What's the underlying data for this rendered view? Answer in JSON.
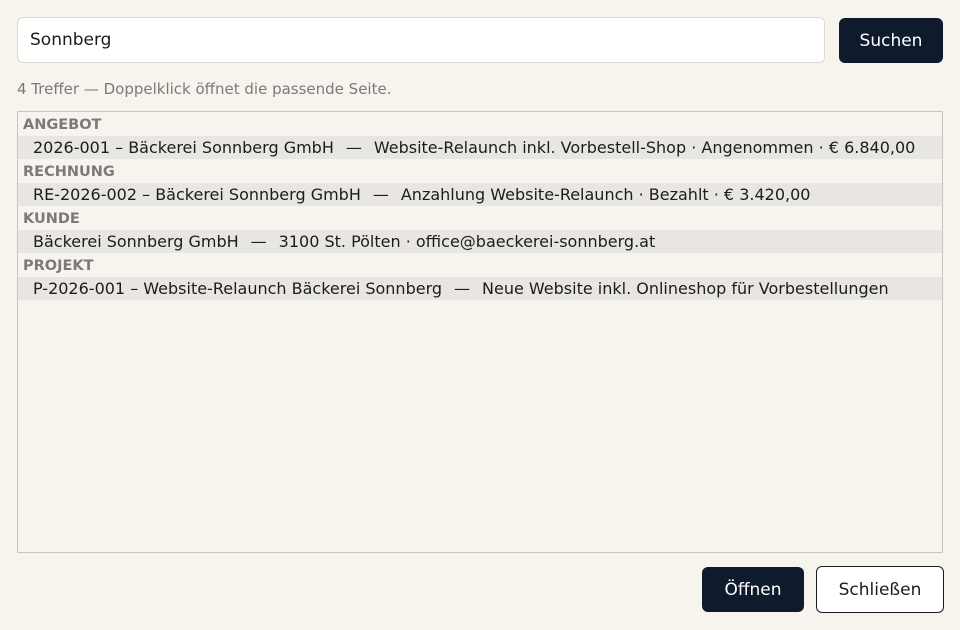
{
  "search": {
    "value": "Sonnberg",
    "button_label": "Suchen"
  },
  "hint": "4 Treffer — Doppelklick öffnet die passende Seite.",
  "results": [
    {
      "group": "ANGEBOT",
      "title": "2026-001 – Bäckerei Sonnberg GmbH",
      "separator": "—",
      "detail": "Website-Relaunch inkl. Vorbestell-Shop · Angenommen · € 6.840,00"
    },
    {
      "group": "RECHNUNG",
      "title": "RE-2026-002 – Bäckerei Sonnberg GmbH",
      "separator": "—",
      "detail": "Anzahlung Website-Relaunch · Bezahlt · € 3.420,00"
    },
    {
      "group": "KUNDE",
      "title": "Bäckerei Sonnberg GmbH",
      "separator": "—",
      "detail": "3100 St. Pölten · office@baeckerei-sonnberg.at"
    },
    {
      "group": "PROJEKT",
      "title": "P-2026-001 – Website-Relaunch Bäckerei Sonnberg",
      "separator": "—",
      "detail": "Neue Website inkl. Onlineshop für Vorbestellungen"
    }
  ],
  "footer": {
    "open_label": "Öffnen",
    "close_label": "Schließen"
  },
  "colors": {
    "background": "#f7f4ee",
    "primary_button": "#0f1b2d",
    "row_background": "#e8e6e2",
    "muted_text": "#7a7a7a"
  }
}
